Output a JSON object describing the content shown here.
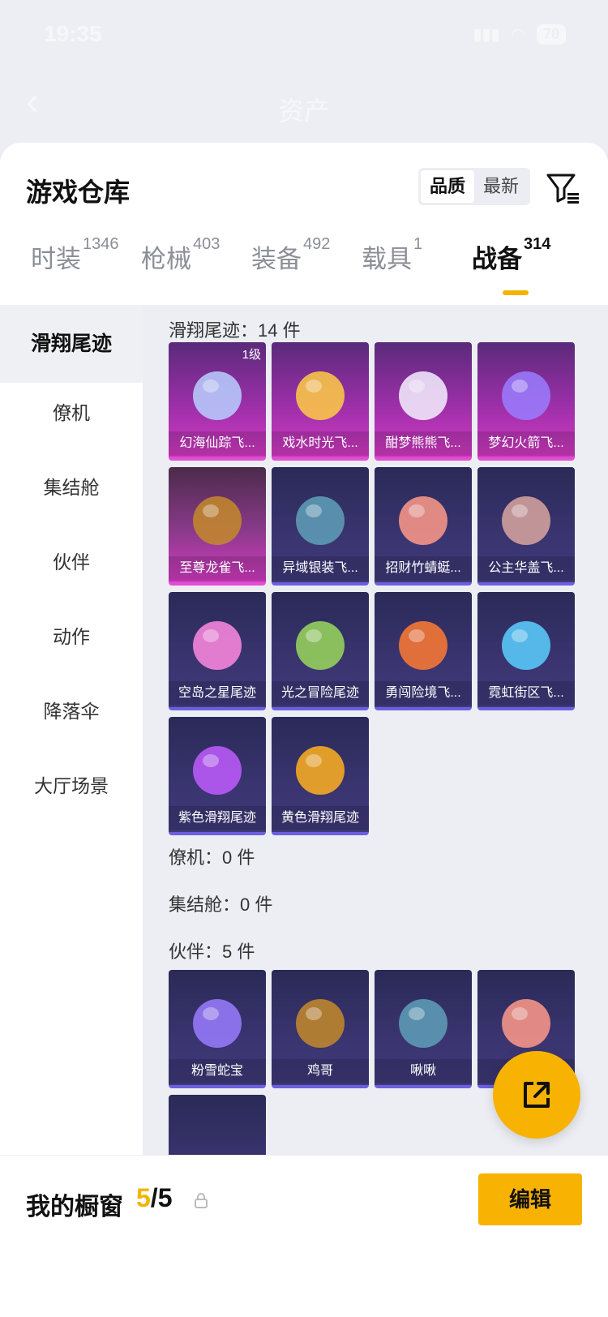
{
  "status": {
    "time": "19:35",
    "battery": "70"
  },
  "nav": {
    "title": "资产"
  },
  "header": {
    "title": "游戏仓库",
    "sort_quality": "品质",
    "sort_newest": "最新"
  },
  "tabs": [
    {
      "label": "时装",
      "count": "1346"
    },
    {
      "label": "枪械",
      "count": "403"
    },
    {
      "label": "装备",
      "count": "492"
    },
    {
      "label": "载具",
      "count": "1"
    },
    {
      "label": "战备",
      "count": "314"
    }
  ],
  "sidenav": [
    "滑翔尾迹",
    "僚机",
    "集结舱",
    "伙伴",
    "动作",
    "降落伞",
    "大厅场景"
  ],
  "sections": {
    "glide": {
      "label": "滑翔尾迹：14 件"
    },
    "wingman": {
      "label": "僚机：0 件"
    },
    "pod": {
      "label": "集结舱：0 件"
    },
    "partner": {
      "label": "伙伴：5 件"
    }
  },
  "glide_items": [
    {
      "name": "幻海仙踪飞...",
      "level": "1级",
      "style": "purple"
    },
    {
      "name": "戏水时光飞...",
      "style": "purple"
    },
    {
      "name": "酣梦熊熊飞...",
      "style": "purple"
    },
    {
      "name": "梦幻火箭飞...",
      "style": "purple"
    },
    {
      "name": "至尊龙雀飞...",
      "style": "gold"
    },
    {
      "name": "异域银装飞...",
      "style": "blue"
    },
    {
      "name": "招财竹蜻蜓...",
      "style": "blue"
    },
    {
      "name": "公主华盖飞...",
      "style": "blue"
    },
    {
      "name": "空岛之星尾迹",
      "style": "blue"
    },
    {
      "name": "光之冒险尾迹",
      "style": "blue"
    },
    {
      "name": "勇闯险境飞...",
      "style": "blue"
    },
    {
      "name": "霓虹街区飞...",
      "style": "blue"
    },
    {
      "name": "紫色滑翔尾迹",
      "style": "blue"
    },
    {
      "name": "黄色滑翔尾迹",
      "style": "blue"
    }
  ],
  "partner_items": [
    {
      "name": "粉雪蛇宝"
    },
    {
      "name": "鸡哥"
    },
    {
      "name": "啾啾"
    },
    {
      "name": ""
    }
  ],
  "bottom": {
    "label": "我的橱窗",
    "count_current": "5",
    "count_total": "/5",
    "edit_label": "编辑"
  },
  "colors": {
    "accent": "#f7b202",
    "purple_card": "#d43bc4",
    "blue_card": "#3f3a7a"
  }
}
